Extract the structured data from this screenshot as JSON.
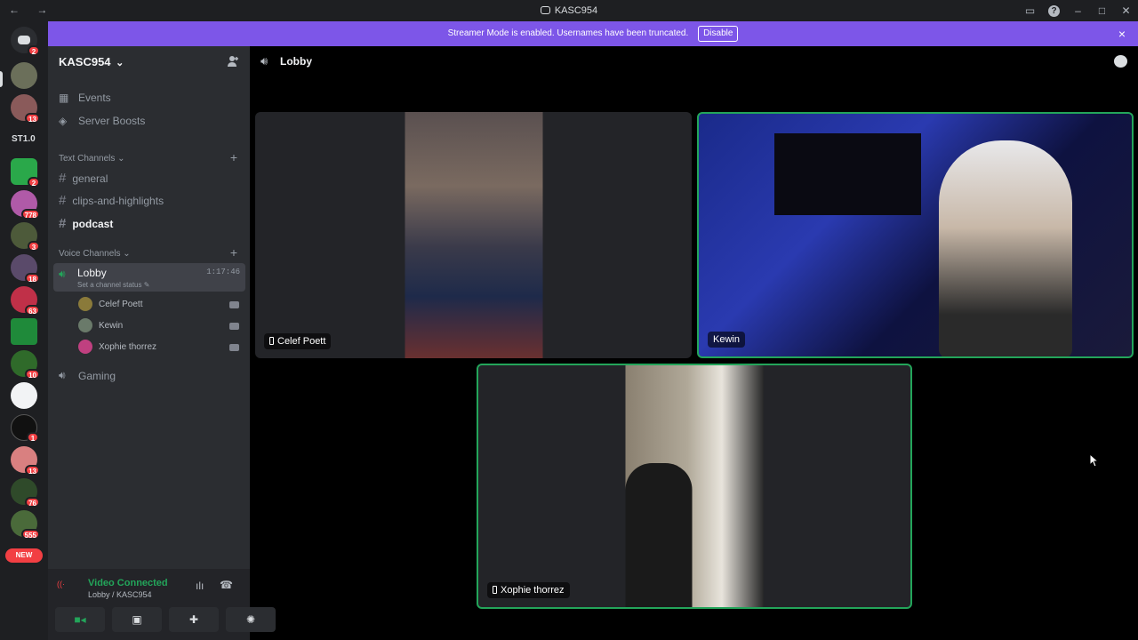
{
  "window": {
    "title": "KASC954",
    "nav_arrows": "←  →"
  },
  "banner": {
    "message": "Streamer Mode is enabled. Usernames have been truncated.",
    "disable_label": "Disable",
    "close_icon": "×"
  },
  "servers": {
    "badges": [
      "2",
      "13",
      "2",
      "778",
      "3",
      "18",
      "63",
      "10",
      "1",
      "13",
      "76",
      "555"
    ],
    "labels": [
      "ST1.0"
    ],
    "new_label": "NEW"
  },
  "guild": {
    "name": "KASC954",
    "chevron": "⌄"
  },
  "sidebar": {
    "events": "Events",
    "boosts": "Server Boosts",
    "text_category": "Text Channels",
    "text_channels": [
      "general",
      "clips-and-highlights",
      "podcast"
    ],
    "voice_category": "Voice Channels",
    "lobby": {
      "name": "Lobby",
      "time": "1:17:46",
      "status": "Set a channel status"
    },
    "members": [
      "Celef Poett",
      "Kewin",
      "Xophie thorrez"
    ],
    "gaming": "Gaming"
  },
  "user_panel": {
    "status": "Video Connected",
    "location": "Lobby / KASC954"
  },
  "header": {
    "channel": "Lobby"
  },
  "tiles": [
    {
      "name": "Celef Poett",
      "speaking": false
    },
    {
      "name": "Kewin",
      "speaking": true
    },
    {
      "name": "Xophie thorrez",
      "speaking": true
    }
  ],
  "colors": {
    "accent": "#7d56e8",
    "speaking": "#23a55a",
    "badge": "#f23f43"
  }
}
